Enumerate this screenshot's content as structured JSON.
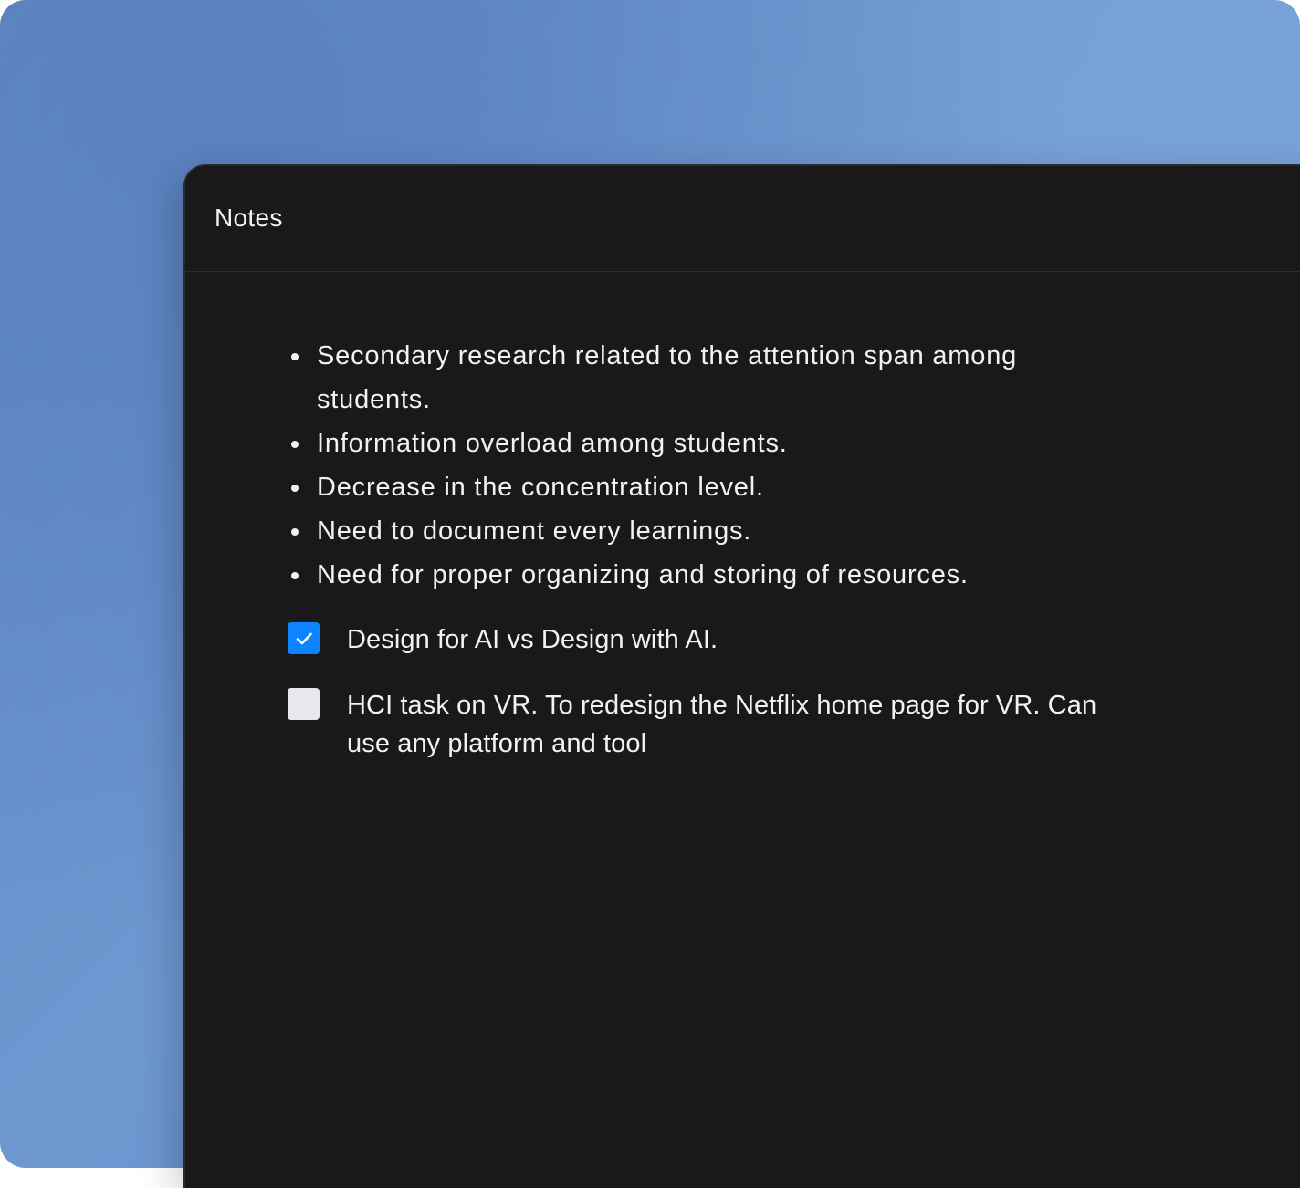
{
  "window": {
    "title": "Notes"
  },
  "notes": {
    "bullets": [
      "Secondary research related to the attention span among students.",
      "Information overload among students.",
      "Decrease in the concentration level.",
      "Need to document every learnings.",
      "Need for proper organizing and storing of resources."
    ],
    "tasks": [
      {
        "label": "Design for AI vs Design with AI.",
        "checked": true,
        "state_icon": "check-icon"
      },
      {
        "label": "HCI task on VR. To redesign the Netflix home page for VR. Can use any platform and tool",
        "checked": false,
        "state_icon": "empty-checkbox-icon"
      }
    ]
  },
  "colors": {
    "background_blue": "#6a92cb",
    "window_dark": "#19191b",
    "text": "#f2f2f2",
    "checkbox_checked": "#0d84ff",
    "checkbox_unchecked": "#e8e8ed"
  }
}
